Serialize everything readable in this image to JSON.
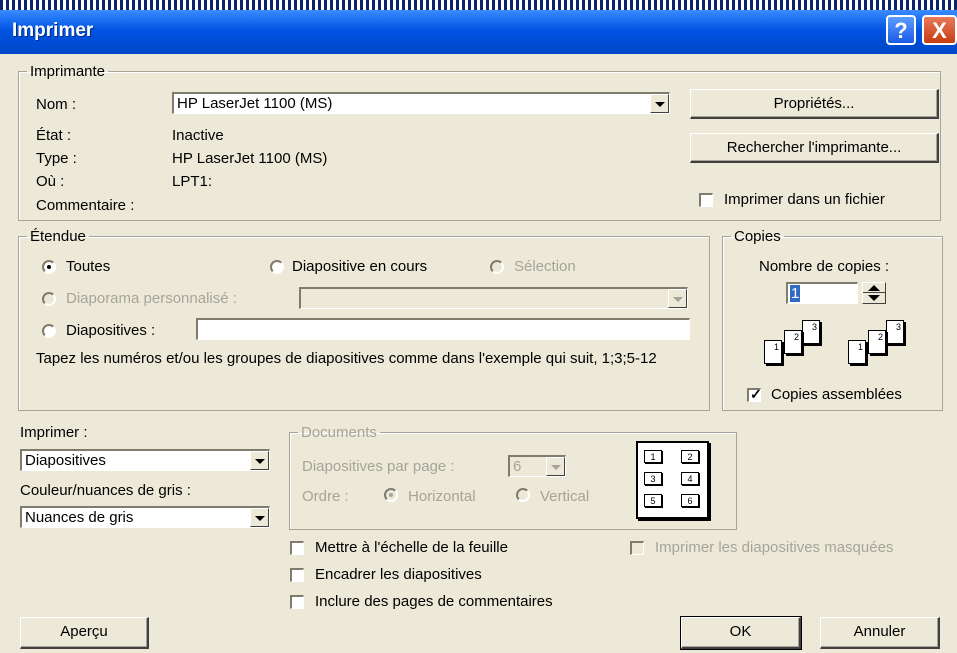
{
  "window": {
    "title": "Imprimer"
  },
  "icons": {
    "help": "?",
    "close": "X"
  },
  "printer": {
    "legend": "Imprimante",
    "name_label": "Nom :",
    "name_value": "HP LaserJet 1100 (MS)",
    "state_label": "État :",
    "state_value": "Inactive",
    "type_label": "Type :",
    "type_value": "HP LaserJet 1100 (MS)",
    "where_label": "Où :",
    "where_value": "LPT1:",
    "comment_label": "Commentaire :",
    "properties_button": "Propriétés...",
    "find_button": "Rechercher l'imprimante...",
    "print_to_file_label": "Imprimer dans un fichier",
    "print_to_file_checked": false
  },
  "range": {
    "legend": "Étendue",
    "all_label": "Toutes",
    "current_slide_label": "Diapositive en cours",
    "selection_label": "Sélection",
    "custom_show_label": "Diaporama personnalisé :",
    "custom_show_value": "",
    "slides_label": "Diapositives :",
    "slides_value": "",
    "hint": "Tapez les numéros et/ou les groupes de diapositives comme dans l'exemple qui suit, 1;3;5-12",
    "selected": "all"
  },
  "copies": {
    "legend": "Copies",
    "count_label": "Nombre de copies :",
    "count_value": "1",
    "collate_label": "Copies assemblées",
    "collate_checked": true,
    "page_numbers": [
      "1",
      "2",
      "3"
    ]
  },
  "print_what": {
    "label": "Imprimer :",
    "value": "Diapositives",
    "color_label": "Couleur/nuances de gris :",
    "color_value": "Nuances de gris"
  },
  "documents": {
    "legend": "Documents",
    "slides_per_page_label": "Diapositives par page :",
    "slides_per_page_value": "6",
    "order_label": "Ordre :",
    "horizontal_label": "Horizontal",
    "vertical_label": "Vertical",
    "order_selected": "horizontal",
    "preview_numbers": [
      "1",
      "2",
      "3",
      "4",
      "5",
      "6"
    ]
  },
  "options": {
    "scale_label": "Mettre à l'échelle de la feuille",
    "frame_label": "Encadrer les diapositives",
    "notes_label": "Inclure des pages de commentaires",
    "hidden_label": "Imprimer les diapositives masquées"
  },
  "footer": {
    "preview_button": "Aperçu",
    "ok_button": "OK",
    "cancel_button": "Annuler"
  }
}
